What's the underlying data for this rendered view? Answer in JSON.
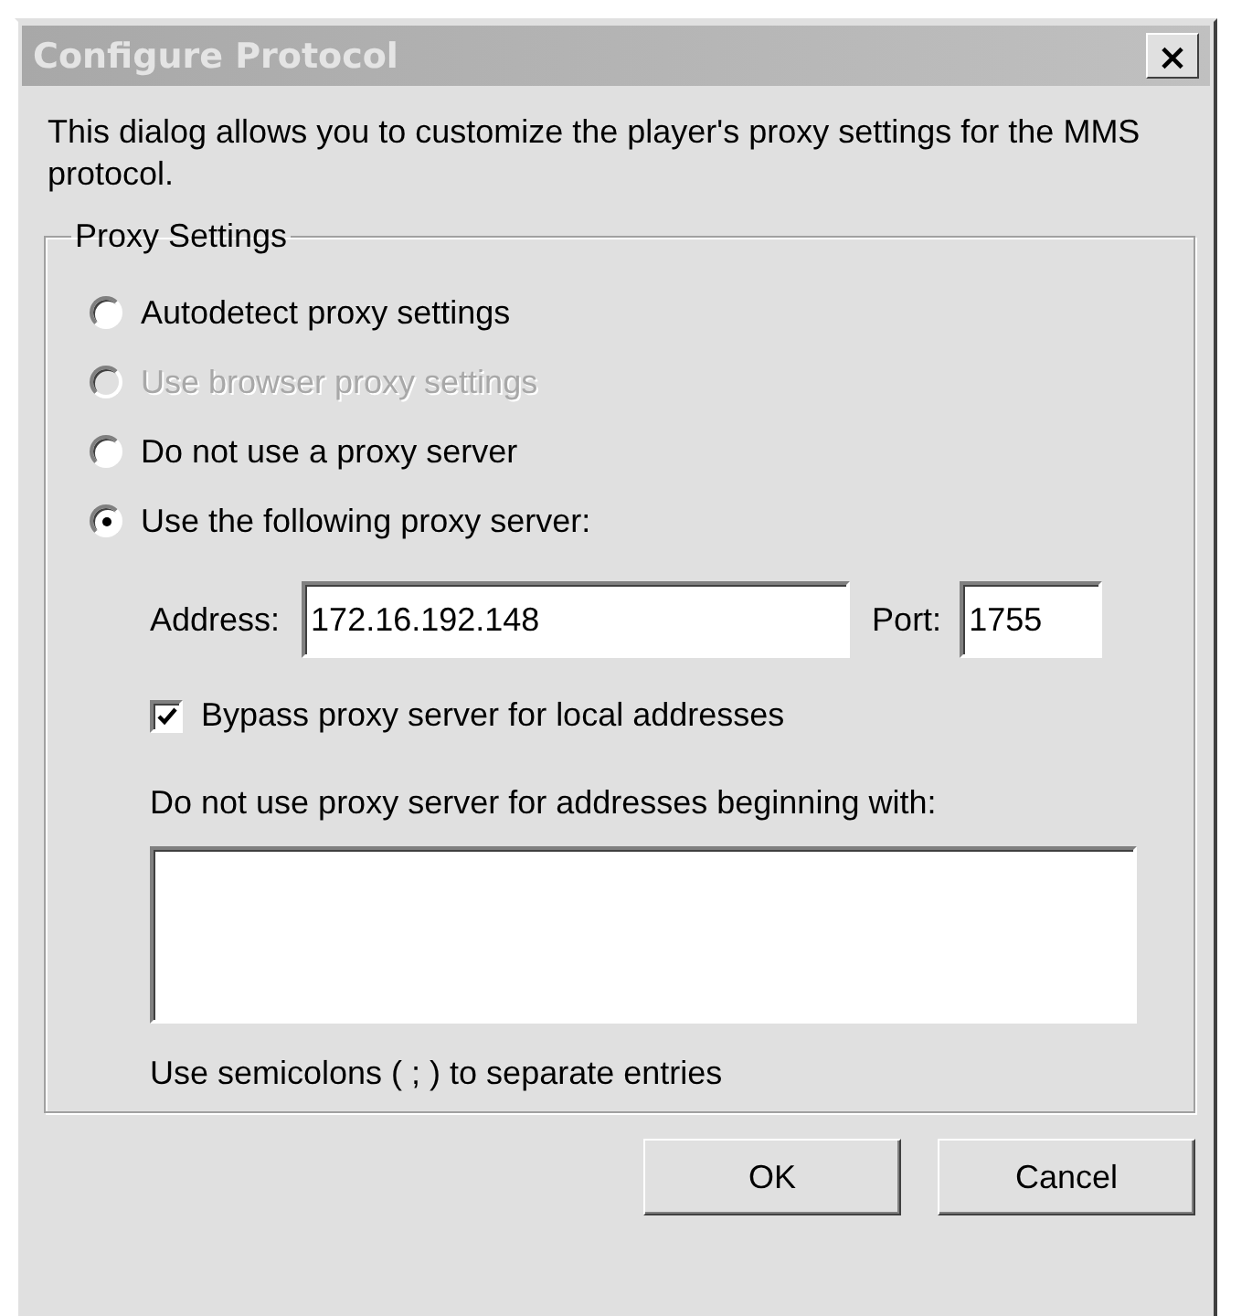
{
  "window": {
    "title": "Configure Protocol",
    "close": "×"
  },
  "description": "This dialog allows you to customize the player's proxy settings for the MMS protocol.",
  "proxy_settings": {
    "legend": "Proxy Settings",
    "options": [
      {
        "label": "Autodetect proxy settings",
        "selected": false,
        "disabled": false
      },
      {
        "label": "Use browser proxy settings",
        "selected": false,
        "disabled": true
      },
      {
        "label": "Do not use a proxy server",
        "selected": false,
        "disabled": false
      },
      {
        "label": "Use the following proxy server:",
        "selected": true,
        "disabled": false
      }
    ],
    "address": {
      "label": "Address:",
      "value": "172.16.192.148"
    },
    "port": {
      "label": "Port:",
      "value": "1755"
    },
    "bypass": {
      "label": "Bypass proxy server for local addresses",
      "checked": true
    },
    "exceptions_label": "Do not use proxy server for addresses beginning with:",
    "exceptions_hint": "Use semicolons ( ; ) to separate entries"
  },
  "buttons": [
    "OK",
    "Cancel"
  ]
}
